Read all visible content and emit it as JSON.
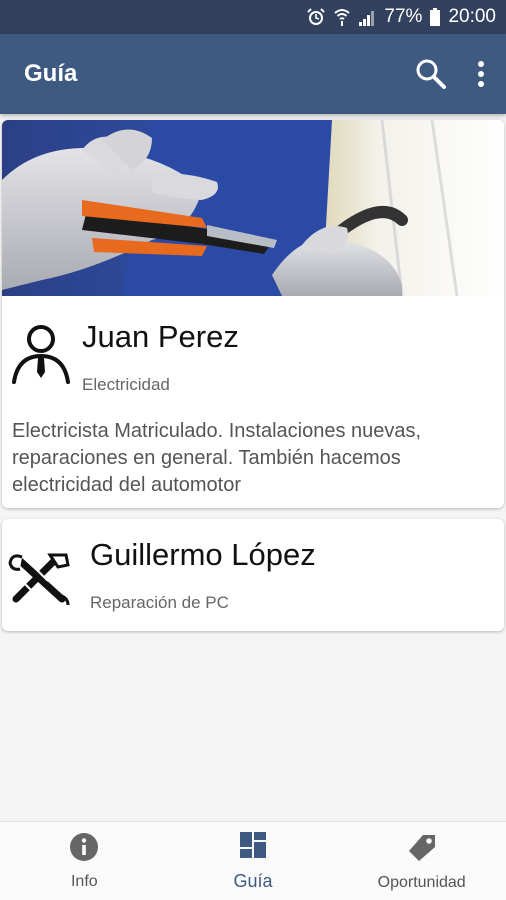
{
  "status_bar": {
    "icons": [
      "alarm-icon",
      "wifi-icon",
      "signal-icon",
      "battery-icon"
    ],
    "battery": "77%",
    "time": "20:00"
  },
  "app_bar": {
    "title": "Guía",
    "actions": [
      "search-icon",
      "more-vert-icon"
    ]
  },
  "listings": [
    {
      "name": "Juan Perez",
      "category": "Electricidad",
      "description": "Electricista Matriculado. Instalaciones nuevas, reparaciones en general. También hacemos electricidad del automotor",
      "icon": "person-tie-icon"
    },
    {
      "name": "Guillermo López",
      "category": "Reparación de PC",
      "icon": "tools-icon"
    }
  ],
  "bottom_nav": {
    "items": [
      {
        "label": "Info",
        "icon": "info-icon"
      },
      {
        "label": "Guía",
        "icon": "dashboard-icon",
        "active": true
      },
      {
        "label": "Oportunidad",
        "icon": "tag-icon"
      }
    ]
  },
  "colors": {
    "status_bar": "#31415e",
    "app_bar": "#3f5a80",
    "accent": "#3f5a80",
    "background": "#f5f5f5"
  }
}
